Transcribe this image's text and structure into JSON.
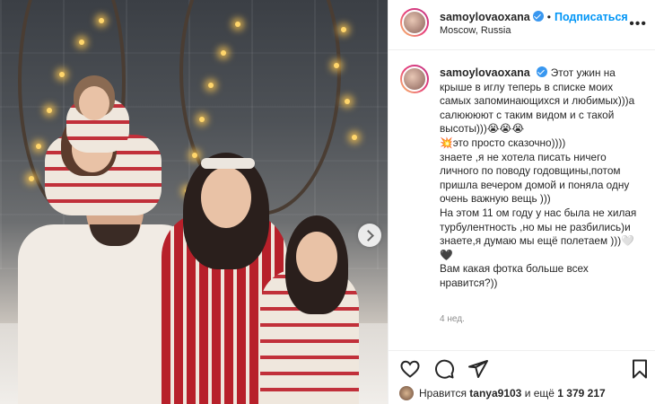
{
  "post": {
    "username": "samoylovaoxana",
    "follow_label": "Подписаться",
    "location": "Moscow, Russia",
    "caption": "Этот ужин на крыше в иглу теперь в списке моих самых запоминающихся и любимых)))а салюююют с таким видом и с такой высоты)))😭😭😭\n💥это просто сказочно))))\nзнаете ,я не хотела писать ничего личного по поводу годовщины,потом пришла вечером домой и поняла одну очень важную вещь )))\nНа этом 11 ом году у нас была не хилая турбулентность ,но мы не разбились)и знаете,я думаю мы ещё полетаем )))🤍🖤\nВам какая фотка больше всех нравится?))",
    "time_ago": "4 нед.",
    "likes_prefix": "Нравится",
    "likes_user": "tanya9103",
    "likes_middle": "и ещё",
    "likes_count": "1 379 217"
  },
  "icons": {
    "verified": "verified-badge-icon",
    "more": "more-options-icon",
    "like": "heart-icon",
    "comment": "comment-icon",
    "share": "paper-plane-icon",
    "save": "bookmark-icon",
    "next": "chevron-right-icon"
  },
  "colors": {
    "accent": "#0095f6",
    "verified": "#3897f0",
    "text": "#262626",
    "muted": "#8e8e8e"
  }
}
